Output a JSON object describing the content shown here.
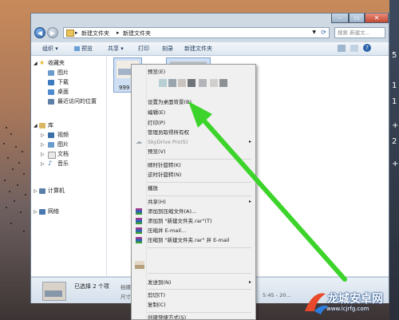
{
  "window": {
    "address": {
      "segments": [
        "新建文件夹",
        "新建文件夹"
      ],
      "search_placeholder": "搜索 新建文..."
    },
    "toolbar": {
      "items": [
        "组织 ▾",
        "预览",
        "共享 ▾",
        "打印",
        "刻录",
        "新建文件夹"
      ]
    },
    "nav": {
      "favorites": {
        "label": "收藏夹",
        "items": [
          "图片",
          "下载",
          "桌面",
          "最近访问的位置"
        ]
      },
      "libraries": {
        "label": "库",
        "items": [
          "视频",
          "图片",
          "文档",
          "音乐"
        ]
      },
      "computer": "计算机",
      "network": "网络"
    },
    "content": {
      "file1_label": "999"
    },
    "details": {
      "selected_text": "已选择 2 个项",
      "taken_label": "拍摄日",
      "size_label": "尺寸",
      "time_text": "5:45 - 20..."
    }
  },
  "context_menu": {
    "items": [
      {
        "label": "预览(E)"
      },
      {
        "label": "设置为桌面背景(B)"
      },
      {
        "label": "编辑(E)"
      },
      {
        "label": "打印(P)"
      },
      {
        "label": "管理员取得所有权"
      },
      {
        "label": "SkyDrive Pro(S)",
        "disabled": true,
        "submenu": true
      },
      {
        "label": "预览(V)"
      },
      {
        "label": "顺时针旋转(K)"
      },
      {
        "label": "逆时针旋转(N)"
      },
      {
        "label": "播放"
      },
      {
        "label": "共享(H)",
        "submenu": true
      },
      {
        "label": "添加到压缩文件(A)..."
      },
      {
        "label": "添加到 \"新建文件夹.rar\"(T)"
      },
      {
        "label": "压缩并 E-mail..."
      },
      {
        "label": "压缩到 \"新建文件夹.rar\" 并 E-mail"
      },
      {
        "label": "发送到(N)",
        "submenu": true
      },
      {
        "label": "剪切(T)"
      },
      {
        "label": "复制(C)"
      },
      {
        "label": "创建快捷方式(S)"
      }
    ]
  },
  "desktop": {
    "clock_glyphs": [
      "5",
      "1",
      "1",
      "+",
      "2",
      "+"
    ]
  },
  "watermark": {
    "title": "龙城安卓网",
    "url": "www.lcjrfg.com"
  },
  "colors": {
    "arrow": "#3cd42a",
    "window_frame": "#cfd9e4",
    "link": "#1e395b"
  }
}
